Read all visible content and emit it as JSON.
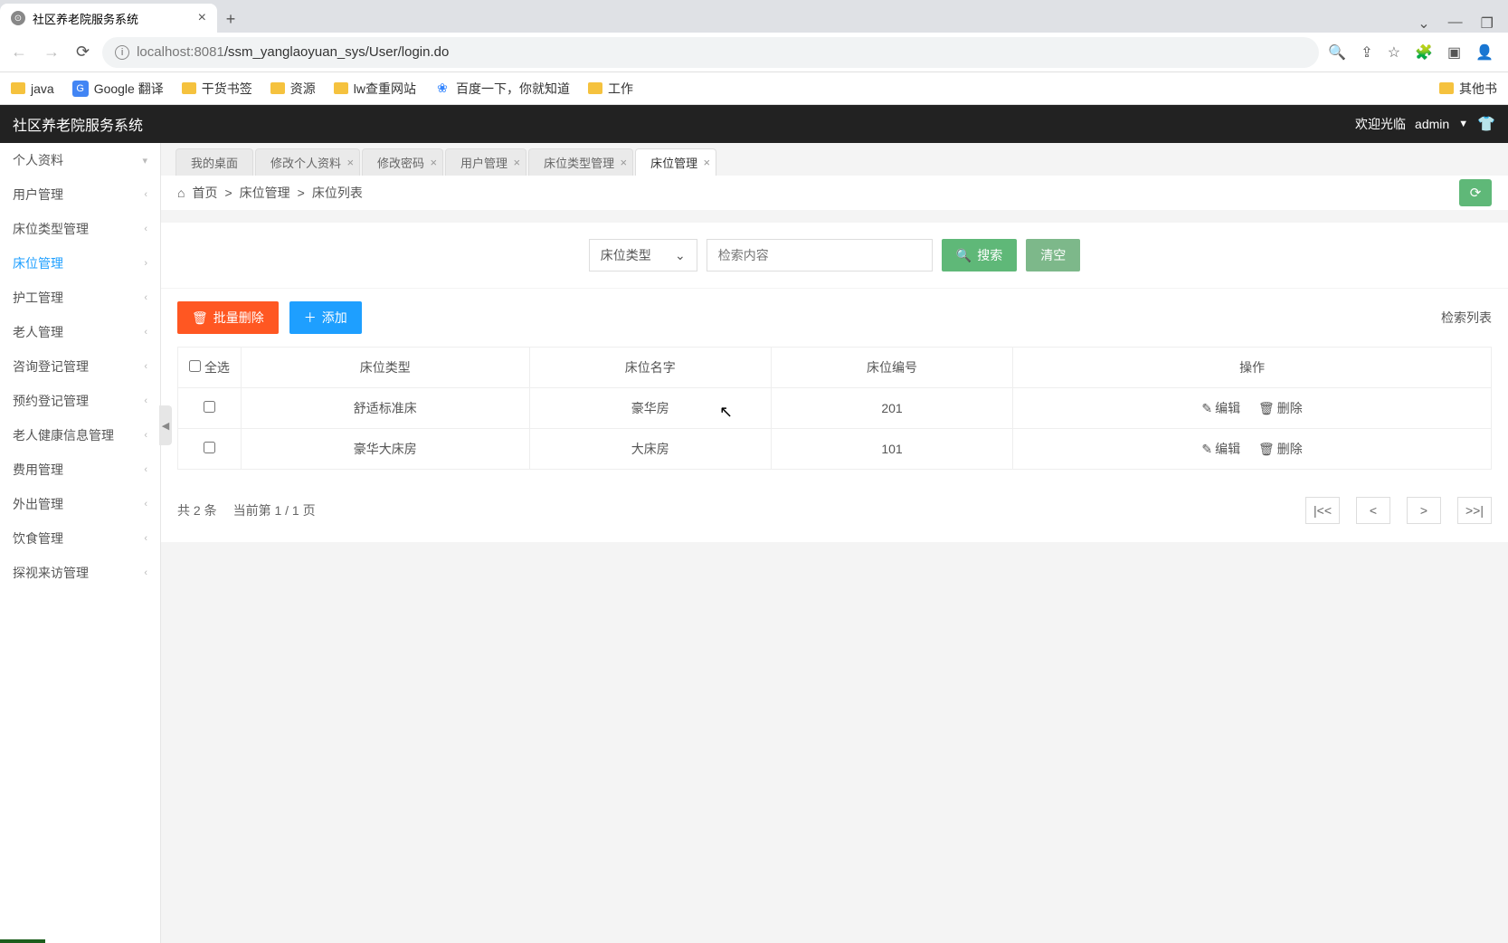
{
  "browser": {
    "tab_title": "社区养老院服务系统",
    "url_host": "localhost",
    "url_port": ":8081",
    "url_path": "/ssm_yanglaoyuan_sys/User/login.do",
    "bookmarks": [
      "java",
      "Google 翻译",
      "干货书签",
      "资源",
      "lw查重网站",
      "百度一下，你就知道",
      "工作"
    ],
    "other_bookmarks": "其他书"
  },
  "app": {
    "title": "社区养老院服务系统",
    "welcome": "欢迎光临",
    "user": "admin"
  },
  "sidebar": {
    "items": [
      {
        "label": "个人资料",
        "open": true
      },
      {
        "label": "用户管理"
      },
      {
        "label": "床位类型管理"
      },
      {
        "label": "床位管理",
        "active": true
      },
      {
        "label": "护工管理"
      },
      {
        "label": "老人管理"
      },
      {
        "label": "咨询登记管理"
      },
      {
        "label": "预约登记管理"
      },
      {
        "label": "老人健康信息管理"
      },
      {
        "label": "费用管理"
      },
      {
        "label": "外出管理"
      },
      {
        "label": "饮食管理"
      },
      {
        "label": "探视来访管理"
      }
    ]
  },
  "tabs": [
    {
      "label": "我的桌面",
      "closable": false
    },
    {
      "label": "修改个人资料",
      "closable": true
    },
    {
      "label": "修改密码",
      "closable": true
    },
    {
      "label": "用户管理",
      "closable": true
    },
    {
      "label": "床位类型管理",
      "closable": true
    },
    {
      "label": "床位管理",
      "closable": true,
      "active": true
    }
  ],
  "breadcrumb": {
    "home": "首页",
    "sep": ">",
    "l1": "床位管理",
    "l2": "床位列表"
  },
  "search": {
    "select_label": "床位类型",
    "placeholder": "检索内容",
    "search_btn": "搜索",
    "clear_btn": "清空"
  },
  "toolbar": {
    "batch_delete": "批量删除",
    "add": "添加",
    "list_label": "检索列表"
  },
  "table": {
    "headers": {
      "select_all": "全选",
      "type": "床位类型",
      "name": "床位名字",
      "number": "床位编号",
      "ops": "操作"
    },
    "rows": [
      {
        "type": "舒适标准床",
        "name": "豪华房",
        "number": "201"
      },
      {
        "type": "豪华大床房",
        "name": "大床房",
        "number": "101"
      }
    ],
    "edit": "编辑",
    "delete": "删除"
  },
  "pager": {
    "total": "共 2 条",
    "current": "当前第  1 / 1 页",
    "first": "|<<",
    "prev": "<",
    "next": ">",
    "last": ">>|"
  }
}
